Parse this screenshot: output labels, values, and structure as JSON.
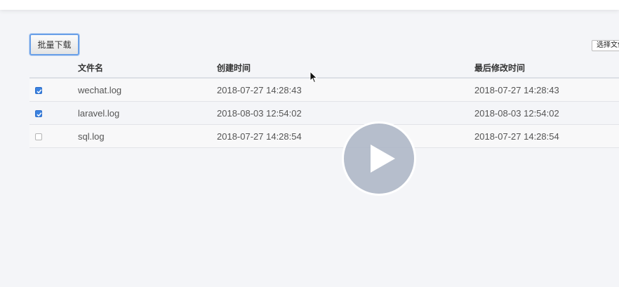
{
  "toolbar": {
    "batch_download_label": "批量下载",
    "choose_file_label": "选择文件"
  },
  "table": {
    "headers": {
      "name": "文件名",
      "created": "创建时间",
      "modified": "最后修改时间"
    },
    "rows": [
      {
        "checked": true,
        "name": "wechat.log",
        "created": "2018-07-27 14:28:43",
        "modified": "2018-07-27 14:28:43"
      },
      {
        "checked": true,
        "name": "laravel.log",
        "created": "2018-08-03 12:54:02",
        "modified": "2018-08-03 12:54:02"
      },
      {
        "checked": false,
        "name": "sql.log",
        "created": "2018-07-27 14:28:54",
        "modified": "2018-07-27 14:28:54"
      }
    ]
  },
  "overlay": {
    "icon": "play-icon"
  },
  "colors": {
    "accent": "#3b82e0",
    "page_bg": "#f4f5f8"
  }
}
